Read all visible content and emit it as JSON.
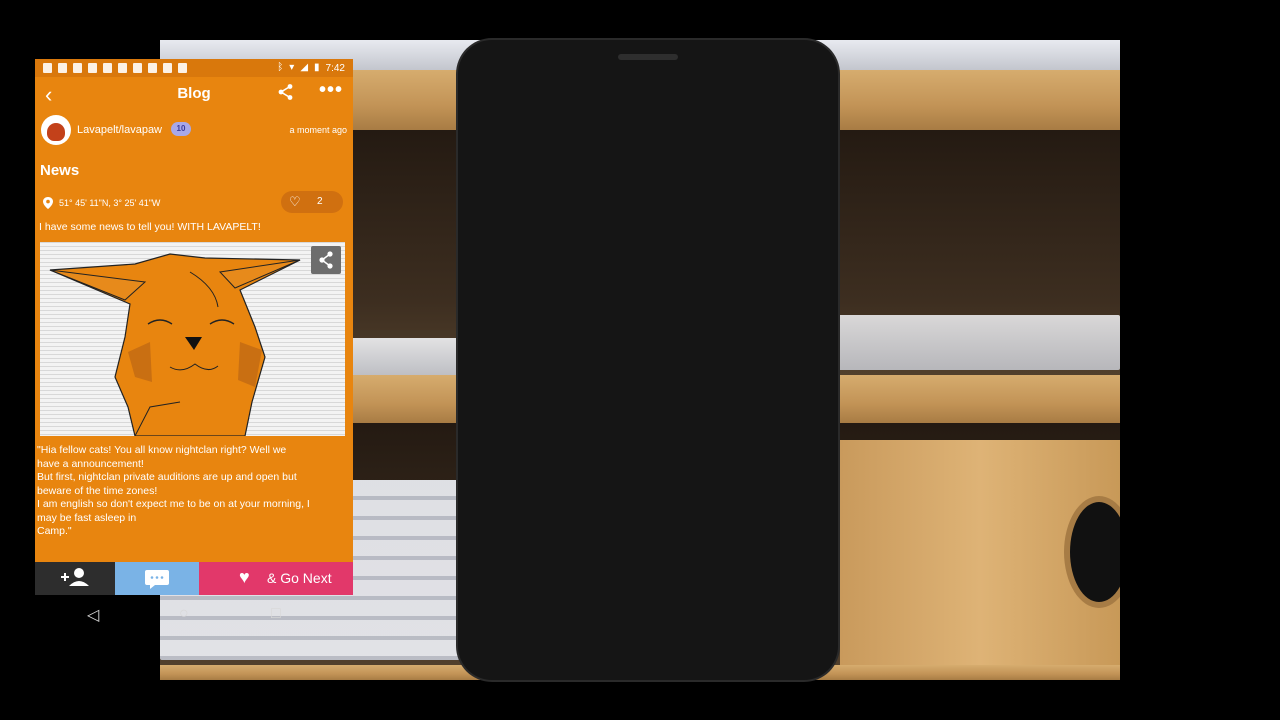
{
  "status": {
    "time": "7:42"
  },
  "appbar": {
    "back_icon": "back-arrow-icon",
    "title": "Blog",
    "share_icon": "share-icon",
    "more_icon": "more-icon"
  },
  "author": {
    "name": "Lavapelt/lavapaw",
    "level": "10",
    "time": "a moment ago"
  },
  "post": {
    "title": "News",
    "location": "51° 45' 11\"N, 3° 25' 41\"W",
    "likes": "2",
    "intro": "I have some news to tell you! WITH LAVAPELT!",
    "body_lines": [
      "\"Hia fellow cats! You all know nightclan right? Well we",
      "have a announcement!",
      "But first, nightclan private auditions are up and open but",
      "beware of the time zones!",
      "I am english so don't expect me to be on at your morning, I",
      "may be fast asleep in",
      "Camp.\""
    ]
  },
  "bottombar": {
    "follow_icon": "add-user-icon",
    "chat_icon": "chat-icon",
    "next_label": "& Go Next"
  },
  "colors": {
    "primary": "#e8850f",
    "next_button": "#e2386a",
    "chat_button": "#7ab3e6"
  }
}
